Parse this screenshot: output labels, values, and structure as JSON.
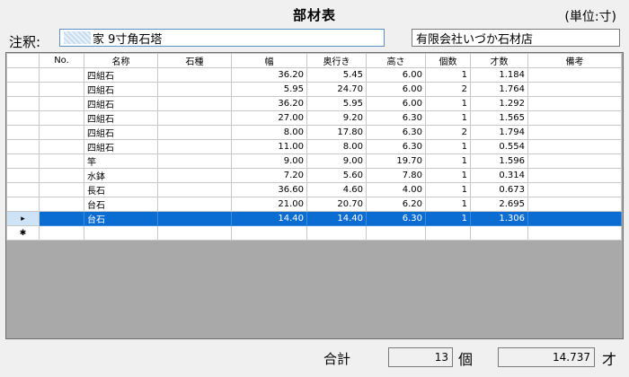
{
  "window": {
    "title": "部材表",
    "unit": "(単位:寸)"
  },
  "note": {
    "label": "注釈:",
    "value": "家 9寸角石塔"
  },
  "company": "有限会社いづか石材店",
  "table": {
    "columns": [
      "No.",
      "名称",
      "石種",
      "幅",
      "奥行き",
      "高さ",
      "個数",
      "才数",
      "備考"
    ],
    "rows": [
      {
        "name": "四組石",
        "stone": "",
        "w": "36.20",
        "d": "5.45",
        "h": "6.00",
        "qty": "1",
        "sai": "1.184",
        "note": ""
      },
      {
        "name": "四組石",
        "stone": "",
        "w": "5.95",
        "d": "24.70",
        "h": "6.00",
        "qty": "2",
        "sai": "1.764",
        "note": ""
      },
      {
        "name": "四組石",
        "stone": "",
        "w": "36.20",
        "d": "5.95",
        "h": "6.00",
        "qty": "1",
        "sai": "1.292",
        "note": ""
      },
      {
        "name": "四組石",
        "stone": "",
        "w": "27.00",
        "d": "9.20",
        "h": "6.30",
        "qty": "1",
        "sai": "1.565",
        "note": ""
      },
      {
        "name": "四組石",
        "stone": "",
        "w": "8.00",
        "d": "17.80",
        "h": "6.30",
        "qty": "2",
        "sai": "1.794",
        "note": ""
      },
      {
        "name": "四組石",
        "stone": "",
        "w": "11.00",
        "d": "8.00",
        "h": "6.30",
        "qty": "1",
        "sai": "0.554",
        "note": ""
      },
      {
        "name": "竿",
        "stone": "",
        "w": "9.00",
        "d": "9.00",
        "h": "19.70",
        "qty": "1",
        "sai": "1.596",
        "note": ""
      },
      {
        "name": "水鉢",
        "stone": "",
        "w": "7.20",
        "d": "5.60",
        "h": "7.80",
        "qty": "1",
        "sai": "0.314",
        "note": ""
      },
      {
        "name": "長石",
        "stone": "",
        "w": "36.60",
        "d": "4.60",
        "h": "4.00",
        "qty": "1",
        "sai": "0.673",
        "note": ""
      },
      {
        "name": "台石",
        "stone": "",
        "w": "21.00",
        "d": "20.70",
        "h": "6.20",
        "qty": "1",
        "sai": "2.695",
        "note": ""
      },
      {
        "name": "台石",
        "stone": "",
        "w": "14.40",
        "d": "14.40",
        "h": "6.30",
        "qty": "1",
        "sai": "1.306",
        "note": ""
      }
    ],
    "selected_row_index": 10,
    "row_header": {
      "selected_marker": "▸",
      "new_row_marker": "✱"
    }
  },
  "footer": {
    "total_label": "合計",
    "total_count": "13",
    "count_unit": "個",
    "total_sai": "14.737",
    "sai_unit": "才"
  },
  "colors": {
    "selection": "#0b6cd1",
    "note_border": "#5b8fc7",
    "empty_area": "#a9a9a9"
  }
}
